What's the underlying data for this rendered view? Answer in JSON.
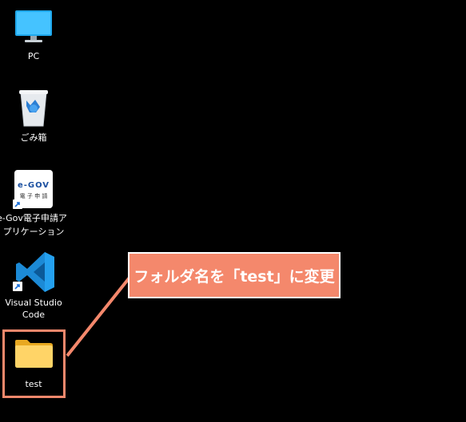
{
  "desktop": {
    "icons": [
      {
        "label": "PC",
        "icon": "monitor-icon"
      },
      {
        "label": "ごみ箱",
        "icon": "recycle-bin-icon"
      },
      {
        "label_line1": "e-Gov電子申請ア",
        "label_line2": "プリケーション",
        "icon": "egov-app-icon",
        "logo_text": "e-GOV",
        "logo_subtext": "電 子 申 請"
      },
      {
        "label_line1": "Visual Studio",
        "label_line2": "Code",
        "icon": "vscode-icon"
      },
      {
        "label": "test",
        "icon": "folder-icon"
      }
    ]
  },
  "annotation": {
    "callout_text": "フォルダ名を「test」に変更",
    "accent_color": "#f4886c"
  }
}
